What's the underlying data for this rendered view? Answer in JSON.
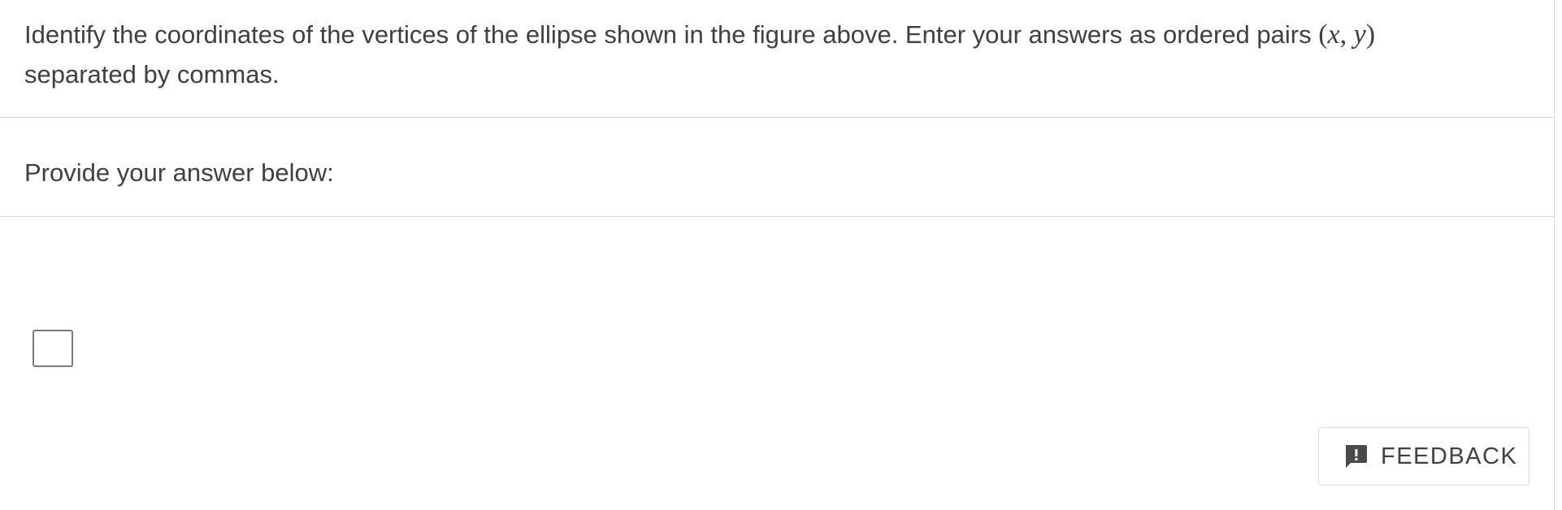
{
  "question": {
    "text_before_math": "Identify the coordinates of the vertices of the ellipse shown in the figure above. Enter your answers as ordered pairs ",
    "math_open": "(",
    "math_x": "x",
    "math_sep": ", ",
    "math_y": "y",
    "math_close": ")",
    "text_after_math": "separated by commas."
  },
  "answer_section": {
    "prompt": "Provide your answer below:",
    "answer_value": ""
  },
  "feedback": {
    "label": "FEEDBACK",
    "icon": "feedback-icon"
  },
  "colors": {
    "text": "#404040",
    "divider": "#d5d5d5",
    "input_border": "#7a7a7a"
  }
}
